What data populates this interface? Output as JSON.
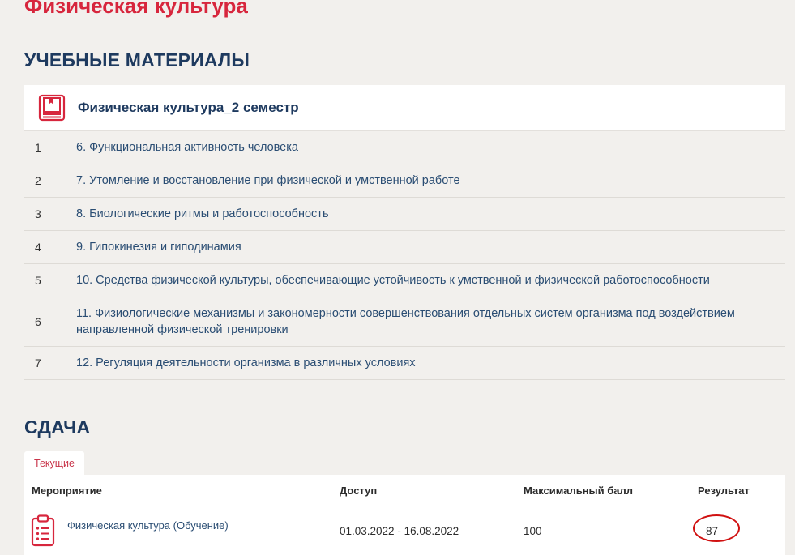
{
  "course": {
    "title": "Физическая культура"
  },
  "materials": {
    "heading": "УЧЕБНЫЕ МАТЕРИАЛЫ",
    "card_title": "Физическая культура_2 семестр",
    "card_icon": "book-icon",
    "lessons": [
      {
        "num": "1",
        "title": "6. Функциональная активность человека"
      },
      {
        "num": "2",
        "title": "7. Утомление и восстановление при физической и умственной работе"
      },
      {
        "num": "3",
        "title": "8. Биологические ритмы и работоспособность"
      },
      {
        "num": "4",
        "title": "9. Гипокинезия и гиподинамия"
      },
      {
        "num": "5",
        "title": "10. Средства физической культуры, обеспечивающие устойчивость к умственной и физической работоспособности"
      },
      {
        "num": "6",
        "title": "11. Физиологические механизмы и закономерности совершенствования отдельных систем организма под воздействием направленной физической тренировки"
      },
      {
        "num": "7",
        "title": "12. Регуляция деятельности организма в различных условиях"
      }
    ]
  },
  "submission": {
    "heading": "СДАЧА",
    "tab_current": "Текущие",
    "columns": [
      "Мероприятие",
      "Доступ",
      "Максимальный балл",
      "Результат"
    ],
    "rows": [
      {
        "event": "Физическая культура (Обучение)",
        "access": "01.03.2022 - 16.08.2022",
        "max_score": "100",
        "result": "87",
        "icon": "clipboard-list-icon"
      }
    ]
  },
  "colors": {
    "accent_red": "#d7263d",
    "heading_navy": "#1e3a5f",
    "link_blue": "#2a4d73",
    "annotation_red": "#d01010",
    "background": "#f2f0ed"
  }
}
